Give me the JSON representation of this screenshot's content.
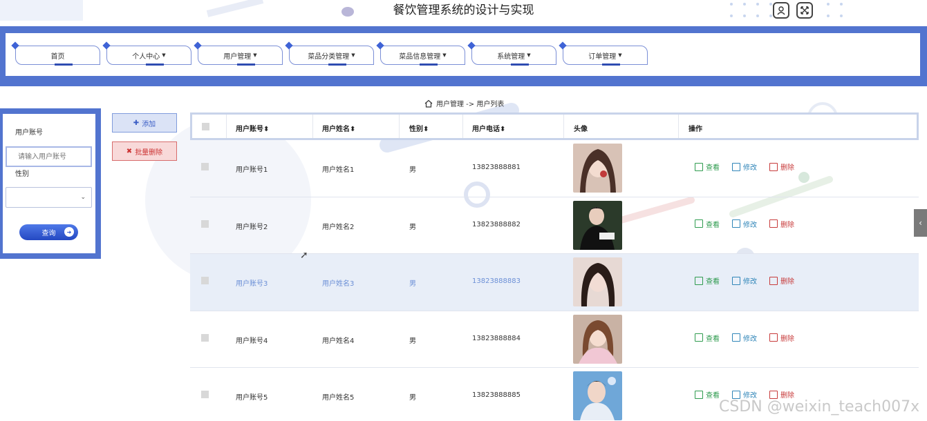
{
  "app": {
    "title": "餐饮管理系统的设计与实现"
  },
  "nav": {
    "items": [
      {
        "label": "首页",
        "has_dropdown": false
      },
      {
        "label": "个人中心",
        "has_dropdown": true
      },
      {
        "label": "用户管理",
        "has_dropdown": true
      },
      {
        "label": "菜品分类管理",
        "has_dropdown": true
      },
      {
        "label": "菜品信息管理",
        "has_dropdown": true
      },
      {
        "label": "系统管理",
        "has_dropdown": true
      },
      {
        "label": "订单管理",
        "has_dropdown": true
      }
    ]
  },
  "breadcrumb": {
    "text": "用户管理 -> 用户列表",
    "icon": "home-icon"
  },
  "search": {
    "account_label": "用户账号",
    "account_placeholder": "请输入用户账号",
    "gender_label": "性别",
    "gender_value": "",
    "query_button": "查询"
  },
  "actions": {
    "add_label": "添加",
    "batch_delete_label": "批量删除"
  },
  "table": {
    "columns": [
      "用户账号",
      "用户姓名",
      "性别",
      "用户电话",
      "头像",
      "操作"
    ],
    "rows": [
      {
        "account": "用户账号1",
        "name": "用户姓名1",
        "gender": "男",
        "phone": "13823888881"
      },
      {
        "account": "用户账号2",
        "name": "用户姓名2",
        "gender": "男",
        "phone": "13823888882"
      },
      {
        "account": "用户账号3",
        "name": "用户姓名3",
        "gender": "男",
        "phone": "13823888883"
      },
      {
        "account": "用户账号4",
        "name": "用户姓名4",
        "gender": "男",
        "phone": "13823888884"
      },
      {
        "account": "用户账号5",
        "name": "用户姓名5",
        "gender": "男",
        "phone": "13823888885"
      }
    ],
    "ops": {
      "view": "查看",
      "edit": "修改",
      "delete": "删除"
    }
  },
  "watermark": "CSDN @weixin_teach007x",
  "colors": {
    "accent": "#5274cf",
    "view": "#2e9b4e",
    "edit": "#2f85b8",
    "delete": "#c73a3a",
    "highlight_row": "#e8eef8"
  }
}
